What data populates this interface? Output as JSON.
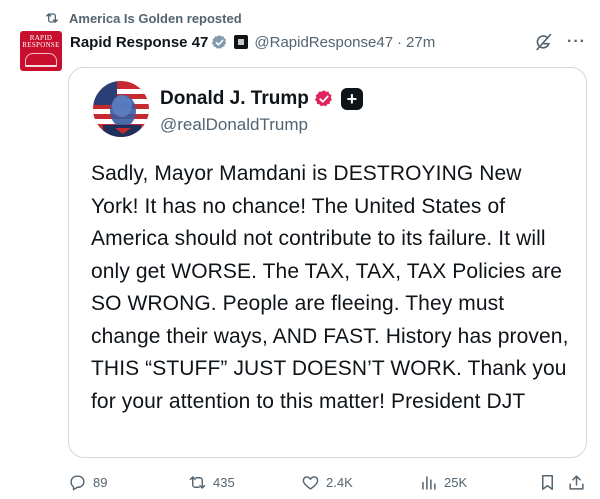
{
  "repost": {
    "icon": "repost-icon",
    "text": "America Is Golden reposted"
  },
  "post": {
    "avatar_line1": "RAPID",
    "avatar_line2": "RESPONSE",
    "author_name": "Rapid Response 47",
    "handle": "@RapidResponse47",
    "separator": "·",
    "time": "27m",
    "more_label": "···",
    "accent_color": "#1d9bf0"
  },
  "quoted": {
    "author_name": "Donald J. Trump",
    "handle": "@realDonaldTrump",
    "plus_label": "+",
    "badge_color": "#e0245e",
    "text": "Sadly, Mayor Mamdani is DESTROYING New York! It has no chance! The United States of America should not contribute to its failure. It will only get WORSE. The TAX, TAX, TAX Policies are SO WRONG. People are fleeing. They must change their ways, AND FAST. History has proven, THIS “STUFF” JUST DOESN’T WORK. Thank you for your attention to this matter! President DJT"
  },
  "actions": {
    "replies": "89",
    "reposts": "435",
    "likes": "2.4K",
    "views": "25K"
  }
}
